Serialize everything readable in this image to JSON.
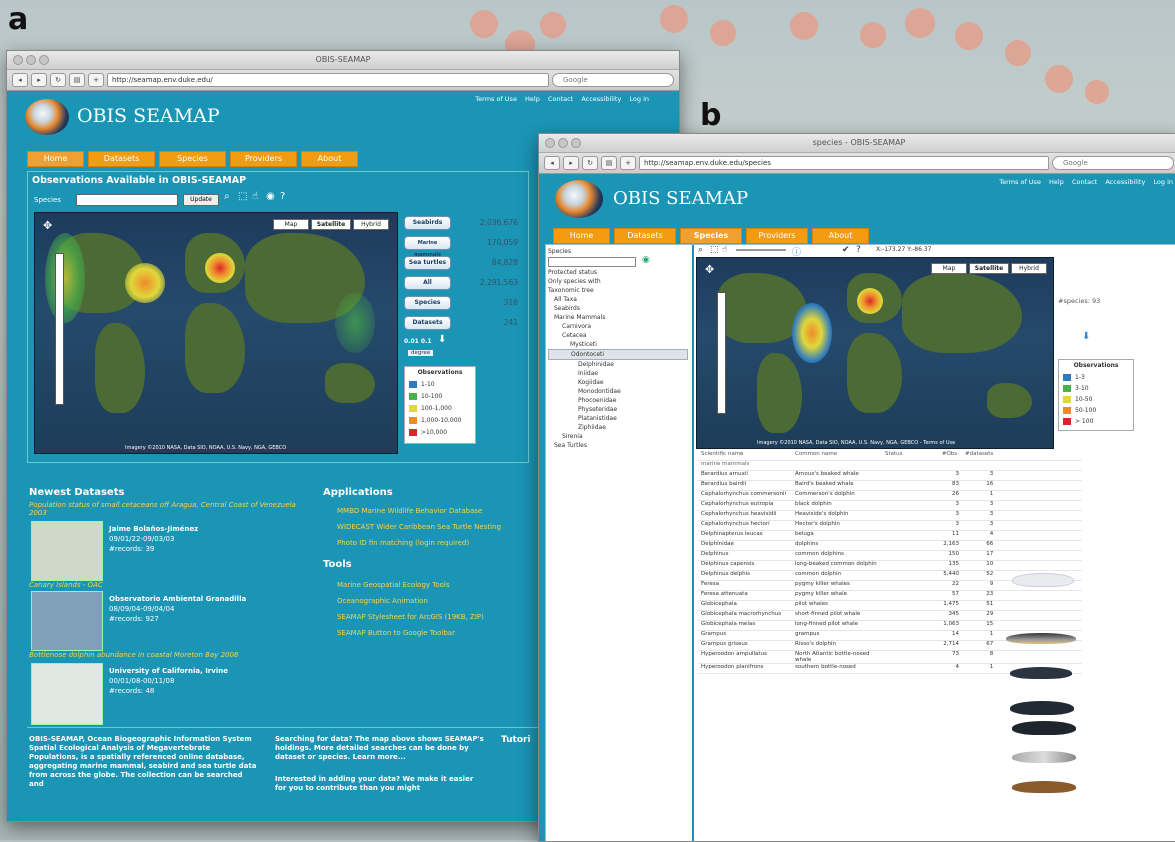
{
  "panel_a_label": "a",
  "panel_b_label": "b",
  "window_a": {
    "title": "OBIS-SEAMAP",
    "url": "http://seamap.env.duke.edu/",
    "search_placeholder": "Google",
    "logo_text": "OBIS SEAMAP",
    "toplinks": [
      "Terms of Use",
      "Help",
      "Contact",
      "Accessibility",
      "Log in"
    ],
    "nav": [
      "Home",
      "Datasets",
      "Species",
      "Providers",
      "About"
    ],
    "obs_title": "Observations Available in OBIS-SEAMAP",
    "species_label": "Species",
    "update_label": "Update",
    "map_buttons": [
      "Map",
      "Satellite",
      "Hybrid"
    ],
    "map_credit": "Imagery ©2010 NASA, Data SIO, NOAA, U.S. Navy, NGA, GEBCO",
    "stats": [
      {
        "label": "Seabirds",
        "value": "2,036,676"
      },
      {
        "label": "Marine mammals",
        "value": "170,059"
      },
      {
        "label": "Sea turtles",
        "value": "84,828"
      },
      {
        "label": "All",
        "value": "2,291,563"
      },
      {
        "label": "Species",
        "value": "316"
      },
      {
        "label": "Datasets",
        "value": "241"
      }
    ],
    "coord_label": "0.01 0.1",
    "degree_label": "degree",
    "legend_title": "Observations",
    "legend": [
      {
        "label": "1-10",
        "color": "#2f7bbf"
      },
      {
        "label": "10-100",
        "color": "#49b14a"
      },
      {
        "label": "100-1,000",
        "color": "#e0d83a"
      },
      {
        "label": "1,000-10,000",
        "color": "#ef8a2c"
      },
      {
        "label": ">10,000",
        "color": "#d9262a"
      }
    ],
    "newest_heading": "Newest Datasets",
    "datasets": [
      {
        "title": "Population status of small cetaceans off Aragua, Central Coast of Venezuela 2003",
        "provider": "Jaime Bolaños-Jiménez",
        "dates": "09/01/22-09/03/03",
        "records": "#records: 39"
      },
      {
        "title": "Canary Islands - OAC",
        "provider": "Observatorio Ambiental Granadilla",
        "dates": "08/09/04-09/04/04",
        "records": "#records: 927"
      },
      {
        "title": "Bottlenose dolphin abundance in coastal Moreton Bay 2008",
        "provider": "University of California, Irvine",
        "dates": "00/01/08-00/11/08",
        "records": "#records: 48"
      }
    ],
    "applications_heading": "Applications",
    "applications": [
      "MMBD Marine Wildlife Behavior Database",
      "WIDECAST Wider Caribbean Sea Turtle Nesting",
      "Photo ID fin matching (login required)"
    ],
    "tools_heading": "Tools",
    "tools": [
      "Marine Geospatial Ecology Tools",
      "Oceanographic Animation",
      "SEAMAP Stylesheet for ArcGIS (19KB, ZIP)",
      "SEAMAP Button to Google Toolbar"
    ],
    "about_text": "OBIS-SEAMAP, Ocean Biogeographic Information System Spatial Ecological Analysis of Megavertebrate Populations, is a spatially referenced online database, aggregating marine mammal, seabird and sea turtle data from across the globe. The collection can be searched and",
    "searching_text": "Searching for data? The map above shows SEAMAP's holdings. More detailed searches can be done by dataset or species. Learn more...",
    "interested_text": "Interested in adding your data? We make it easier for you to contribute than you might",
    "tutorials_heading": "Tutori"
  },
  "window_b": {
    "title": "species - OBIS-SEAMAP",
    "url": "http://seamap.env.duke.edu/species",
    "search_placeholder": "Google",
    "logo_text": "OBIS SEAMAP",
    "toplinks": [
      "Terms of Use",
      "Help",
      "Contact",
      "Accessibility",
      "Log in"
    ],
    "nav": [
      "Home",
      "Datasets",
      "Species",
      "Providers",
      "About"
    ],
    "coords": "X:-173.27 Y:-86.37",
    "map_buttons": [
      "Map",
      "Satellite",
      "Hybrid"
    ],
    "species_count": "#species: 93",
    "map_credit": "Imagery ©2010 NASA, Data SIO, NOAA, U.S. Navy, NGA, GEBCO - Terms of Use",
    "legend_title": "Observations",
    "legend": [
      {
        "label": "1-3",
        "color": "#2f7bbf"
      },
      {
        "label": "3-10",
        "color": "#49b14a"
      },
      {
        "label": "10-50",
        "color": "#e0d83a"
      },
      {
        "label": "50-100",
        "color": "#ef8a2c"
      },
      {
        "label": "> 100",
        "color": "#d9262a"
      }
    ],
    "left_filters": [
      "Species",
      "Protected status",
      "Only species with",
      "Taxonomic tree"
    ],
    "tree": [
      {
        "label": "All Taxa",
        "indent": 1
      },
      {
        "label": "Seabirds",
        "indent": 1
      },
      {
        "label": "Marine Mammals",
        "indent": 1
      },
      {
        "label": "Carnivora",
        "indent": 2
      },
      {
        "label": "Cetacea",
        "indent": 2
      },
      {
        "label": "Mysticeti",
        "indent": 3
      },
      {
        "label": "Odontoceti",
        "indent": 3
      },
      {
        "label": "Delphinidae",
        "indent": 4
      },
      {
        "label": "Iniidae",
        "indent": 4
      },
      {
        "label": "Kogiidae",
        "indent": 4
      },
      {
        "label": "Monodontidae",
        "indent": 4
      },
      {
        "label": "Phocoenidae",
        "indent": 4
      },
      {
        "label": "Physeteridae",
        "indent": 4
      },
      {
        "label": "Platanistidae",
        "indent": 4
      },
      {
        "label": "Ziphiidae",
        "indent": 4
      },
      {
        "label": "Sirenia",
        "indent": 2
      },
      {
        "label": "Sea Turtles",
        "indent": 1
      }
    ],
    "table_headers": [
      "Scientific name",
      "Common name",
      "Status",
      "#Obs.",
      "#datasets"
    ],
    "group_label": "marine mammals",
    "rows": [
      {
        "sci": "Berardius arnuxii",
        "common": "Arnoux's beaked whale",
        "obs": "3",
        "ds": "3"
      },
      {
        "sci": "Berardius bairdii",
        "common": "Baird's beaked whale",
        "obs": "83",
        "ds": "16"
      },
      {
        "sci": "Cephalorhynchus commersonii",
        "common": "Commerson's dolphin",
        "obs": "26",
        "ds": "1"
      },
      {
        "sci": "Cephalorhynchus eutropia",
        "common": "black dolphin",
        "obs": "3",
        "ds": "3"
      },
      {
        "sci": "Cephalorhynchus heavisidii",
        "common": "Heaviside's dolphin",
        "obs": "3",
        "ds": "3"
      },
      {
        "sci": "Cephalorhynchus hectori",
        "common": "Hector's dolphin",
        "obs": "3",
        "ds": "3"
      },
      {
        "sci": "Delphinapterus leucas",
        "common": "beluga",
        "obs": "11",
        "ds": "4"
      },
      {
        "sci": "Delphinidae",
        "common": "dolphins",
        "obs": "2,163",
        "ds": "66"
      },
      {
        "sci": "Delphinus",
        "common": "common dolphins",
        "obs": "150",
        "ds": "17"
      },
      {
        "sci": "Delphinus capensis",
        "common": "long-beaked common dolphin",
        "obs": "135",
        "ds": "10"
      },
      {
        "sci": "Delphinus delphis",
        "common": "common dolphin",
        "obs": "5,440",
        "ds": "52"
      },
      {
        "sci": "Feresa",
        "common": "pygmy killer whales",
        "obs": "22",
        "ds": "9"
      },
      {
        "sci": "Feresa attenuata",
        "common": "pygmy killer whale",
        "obs": "57",
        "ds": "23"
      },
      {
        "sci": "Globicephala",
        "common": "pilot whales",
        "obs": "1,475",
        "ds": "51"
      },
      {
        "sci": "Globicephala macrorhynchus",
        "common": "short-finned pilot whale",
        "obs": "345",
        "ds": "29"
      },
      {
        "sci": "Globicephala melas",
        "common": "long-finned pilot whale",
        "obs": "1,063",
        "ds": "15"
      },
      {
        "sci": "Grampus",
        "common": "grampus",
        "obs": "14",
        "ds": "1"
      },
      {
        "sci": "Grampus griseus",
        "common": "Risso's dolphin",
        "obs": "2,714",
        "ds": "67"
      },
      {
        "sci": "Hyperoodon ampullatus",
        "common": "North Atlantic bottle-nosed whale",
        "obs": "73",
        "ds": "8"
      },
      {
        "sci": "Hyperoodon planifrons",
        "common": "southern bottle-nosed",
        "obs": "4",
        "ds": "1"
      }
    ]
  }
}
